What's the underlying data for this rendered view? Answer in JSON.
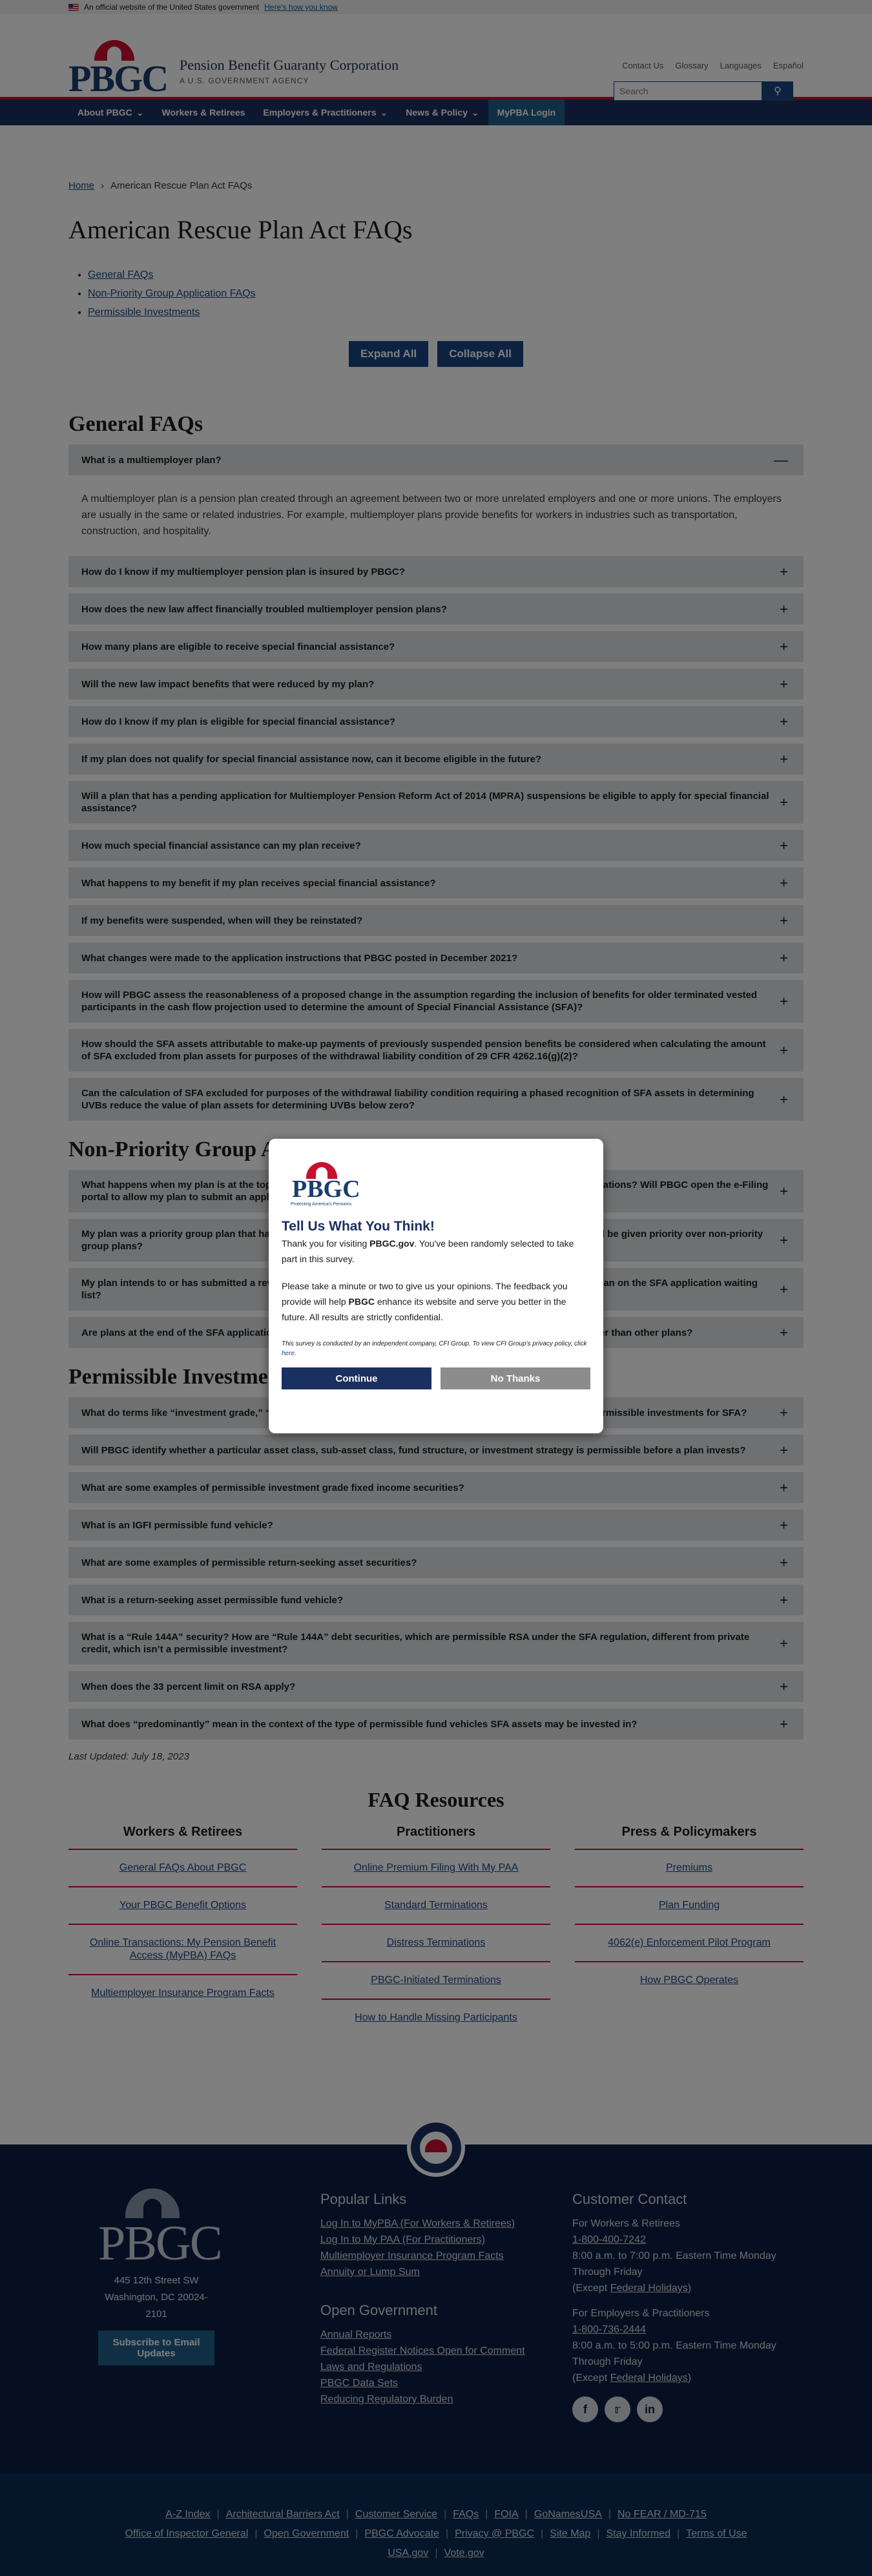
{
  "gov_banner": {
    "text": "An official website of the United States government",
    "link": "Here's how you know"
  },
  "header": {
    "logo_letters": "PBGC",
    "org_name": "Pension Benefit Guaranty Corporation",
    "org_sub": "A U.S. GOVERNMENT AGENCY",
    "utility_links": [
      "Contact Us",
      "Glossary",
      "Languages",
      "Español"
    ],
    "search_placeholder": "Search"
  },
  "nav": {
    "items": [
      "About PBGC",
      "Workers & Retirees",
      "Employers & Practitioners",
      "News & Policy",
      "MyPBA Login"
    ]
  },
  "breadcrumb": {
    "home": "Home",
    "current": "American Rescue Plan Act FAQs"
  },
  "page_title": "American Rescue Plan Act FAQs",
  "toc": [
    "General FAQs",
    "Non-Priority Group Application FAQs",
    "Permissible Investments"
  ],
  "buttons": {
    "expand_all": "Expand All",
    "collapse_all": "Collapse All"
  },
  "sections": [
    {
      "title": "General FAQs",
      "items": [
        "What is a multiemployer plan?",
        "How do I know if my multiemployer pension plan is insured by PBGC?",
        "How does the new law affect financially troubled multiemployer pension plans?",
        "How many plans are eligible to receive special financial assistance?",
        "Will the new law impact benefits that were reduced by my plan?",
        "How do I know if my plan is eligible for special financial assistance?",
        "If my plan does not qualify for special financial assistance now, can it become eligible in the future?",
        "Will a plan that has a pending application for Multiemployer Pension Reform Act of 2014 (MPRA) suspensions be eligible to apply for special financial assistance?",
        "How much special financial assistance can my plan receive?",
        "What happens to my benefit if my plan receives special financial assistance?",
        "If my benefits were suspended, when will they be reinstated?",
        "What changes were made to the application instructions that PBGC posted in December 2021?",
        "How will PBGC assess the reasonableness of a proposed change in the assumption regarding the inclusion of benefits for older terminated vested participants in the cash flow projection used to determine the amount of Special Financial Assistance (SFA)?",
        "How should the SFA assets attributable to make-up payments of previously suspended pension benefits be considered when calculating the amount of SFA excluded from plan assets for purposes of the withdrawal liability condition of 29 CFR 4262.16(g)(2)?",
        "Can the calculation of SFA excluded for purposes of the withdrawal liability condition requiring a phased recognition of SFA assets in determining UVBs reduce the value of plan assets for determining UVBs below zero?"
      ],
      "expanded_answer": "A multiemployer plan is a pension plan created through an agreement between two or more unrelated employers and one or more unions. The employers are usually in the same or related industries. For example, multiemployer plans provide benefits for workers in industries such as transportation, construction, and hospitality."
    },
    {
      "title": "Non-Priority Group Application FAQs",
      "items": [
        "What happens when my plan is at the top of the waiting list and the PBGC e-Filing portal is ready to accept applications? Will PBGC open the e-Filing portal to allow my plan to submit an application?",
        "My plan was a priority group plan that had not submitted its initial application by March 11, 2023. Will my plan still be given priority over non-priority group plans?",
        "My plan intends to or has submitted a revised application, but the e-Filing portal is closed. Will PBGC place the plan on the SFA application waiting list?",
        "Are plans at the end of the SFA application waiting list able to submit an application with a base period that is later than other plans?"
      ]
    },
    {
      "title": "Permissible Investments",
      "items": [
        "What do terms like “investment grade,” “fixed income,” and “permissible investments” mean in the context of permissible investments for SFA?",
        "Will PBGC identify whether a particular asset class, sub-asset class, fund structure, or investment strategy is permissible before a plan invests?",
        "What are some examples of permissible investment grade fixed income securities?",
        "What is an IGFI permissible fund vehicle?",
        "What are some examples of permissible return-seeking asset securities?",
        "What is a return-seeking asset permissible fund vehicle?",
        "What is a “Rule 144A” security? How are “Rule 144A” debt securities, which are permissible RSA under the SFA regulation, different from private credit, which isn’t a permissible investment?",
        "When does the 33 percent limit on RSA apply?",
        "What does “predominantly” mean in the context of the type of permissible fund vehicles SFA assets may be invested in?"
      ]
    }
  ],
  "last_updated": "Last Updated: July 18, 2023",
  "resources": {
    "title": "FAQ Resources",
    "columns": [
      {
        "heading": "Workers & Retirees",
        "links": [
          "General FAQs About PBGC",
          "Your PBGC Benefit Options",
          "Online Transactions: My Pension Benefit Access (MyPBA) FAQs",
          "Multiemployer Insurance Program Facts"
        ]
      },
      {
        "heading": "Practitioners",
        "links": [
          "Online Premium Filing With My PAA",
          "Standard Terminations",
          "Distress Terminations",
          "PBGC-Initiated Terminations",
          "How to Handle Missing Participants"
        ]
      },
      {
        "heading": "Press & Policymakers",
        "links": [
          "Premiums",
          "Plan Funding",
          "4062(e) Enforcement Pilot Program",
          "How PBGC Operates"
        ]
      }
    ]
  },
  "modal": {
    "logo_letters": "PBGC",
    "logo_tag": "Protecting America's Pensions",
    "title": "Tell Us What You Think!",
    "p1_pre": "Thank you for visiting ",
    "p1_bold": "PBGC.gov",
    "p1_post": ". You've been randomly selected to take part in this survey.",
    "p2_pre": "Please take a minute or two to give us your opinions. The feedback you provide will help ",
    "p2_bold": "PBGC",
    "p2_post": " enhance its website and serve you better in the future. All results are strictly confidential.",
    "fine_pre": "This survey is conducted by an independent company, CFI Group. To view CFI Group's privacy policy, click ",
    "fine_link": "here",
    "continue": "Continue",
    "no_thanks": "No Thanks"
  },
  "footer": {
    "logo_letters": "PBGC",
    "address_1": "445 12th Street SW",
    "address_2": "Washington, DC 20024-2101",
    "subscribe": "Subscribe to Email Updates",
    "popular_title": "Popular Links",
    "popular_links": [
      "Log In to MyPBA (For Workers & Retirees)",
      "Log In to My PAA (For Practitioners)",
      "Multiemployer Insurance Program Facts",
      "Annuity or Lump Sum"
    ],
    "open_gov_title": "Open Government",
    "open_gov_links": [
      "Annual Reports",
      "Federal Register Notices Open for Comment",
      "Laws and Regulations",
      "PBGC Data Sets",
      "Reducing Regulatory Burden"
    ],
    "contact_title": "Customer Contact",
    "workers_label": "For Workers & Retirees",
    "workers_phone": "1-800-400-7242",
    "workers_hours": "8:00 a.m. to 7:00 p.m. Eastern Time Monday Through Friday",
    "except_pre": "(Except ",
    "holidays": "Federal Holidays",
    "except_post": ")",
    "employers_label": "For Employers & Practitioners",
    "employers_phone": "1-800-736-2444",
    "employers_hours": "8:00 a.m. to 5:00 p.m. Eastern Time Monday Through Friday",
    "social_icons": [
      "facebook-icon",
      "twitter-icon",
      "linkedin-icon"
    ]
  },
  "subfooter": {
    "row1": [
      "A-Z Index",
      "Architectural Barriers Act",
      "Customer Service",
      "FAQs",
      "FOIA",
      "GoNamesUSA",
      "No FEAR / MD-715"
    ],
    "row2": [
      "Office of Inspector General",
      "Open Government",
      "PBGC Advocate",
      "Privacy @ PBGC",
      "Site Map",
      "Stay Informed",
      "Terms of Use"
    ],
    "row3": [
      "USA.gov",
      "Vote.gov"
    ]
  },
  "colors": {
    "navy": "#1a3060",
    "accent_red": "#c8102e",
    "link": "#1a4480",
    "accordion_bg": "#dfe1e2",
    "footer_bg": "#0a1e42"
  }
}
